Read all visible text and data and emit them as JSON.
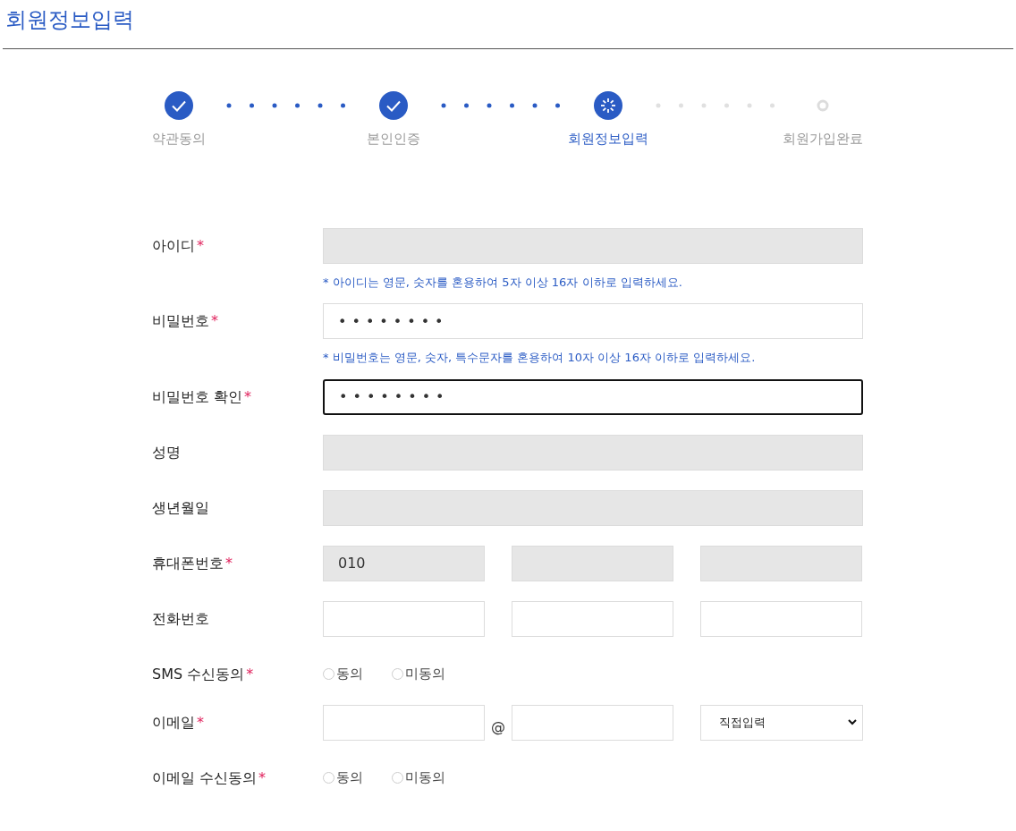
{
  "page_title": "회원정보입력",
  "steps": [
    {
      "label": "약관동의",
      "kind": "done"
    },
    {
      "label": "본인인증",
      "kind": "done"
    },
    {
      "label": "회원정보입력",
      "kind": "current"
    },
    {
      "label": "회원가입완료",
      "kind": "pending"
    }
  ],
  "fields": [
    {
      "kind": "text",
      "label": "아이디",
      "mark": "*",
      "disabled": true,
      "focused": false,
      "hint": "* 아이디는 영문, 숫자를 혼용하여 5자 이상 16자 이하로 입력하세요."
    },
    {
      "kind": "text",
      "label": "비밀번호",
      "mark": "*",
      "disabled": false,
      "focused": false,
      "value": "••••••••",
      "hint": "* 비밀번호는 영문, 숫자, 특수문자를 혼용하여 10자 이상 16자 이하로 입력하세요."
    },
    {
      "kind": "text",
      "label": "비밀번호 확인",
      "mark": "*",
      "disabled": false,
      "focused": true,
      "value": "••••••••"
    },
    {
      "kind": "text",
      "label": "성명",
      "disabled": true,
      "focused": false
    },
    {
      "kind": "text",
      "label": "생년월일",
      "disabled": true,
      "focused": false
    },
    {
      "kind": "triple",
      "label": "휴대폰번호",
      "mark": "*",
      "parts": [
        {
          "value": "010",
          "disabled": true
        },
        {
          "disabled": true
        },
        {
          "disabled": true
        }
      ]
    },
    {
      "kind": "triple",
      "label": "전화번호",
      "parts": [
        {
          "disabled": false
        },
        {
          "disabled": false
        },
        {
          "disabled": false
        }
      ]
    },
    {
      "kind": "radio",
      "label": "SMS 수신동의",
      "mark": "*",
      "options": [
        {
          "label": "동의",
          "selected": false
        },
        {
          "label": "미동의",
          "selected": false
        }
      ]
    },
    {
      "kind": "email",
      "label": "이메일",
      "mark": "*",
      "at": "@",
      "select": "직접입력"
    },
    {
      "kind": "radio",
      "label": "이메일 수신동의",
      "mark": "*",
      "options": [
        {
          "label": "동의",
          "selected": false
        },
        {
          "label": "미동의",
          "selected": false
        }
      ]
    }
  ]
}
